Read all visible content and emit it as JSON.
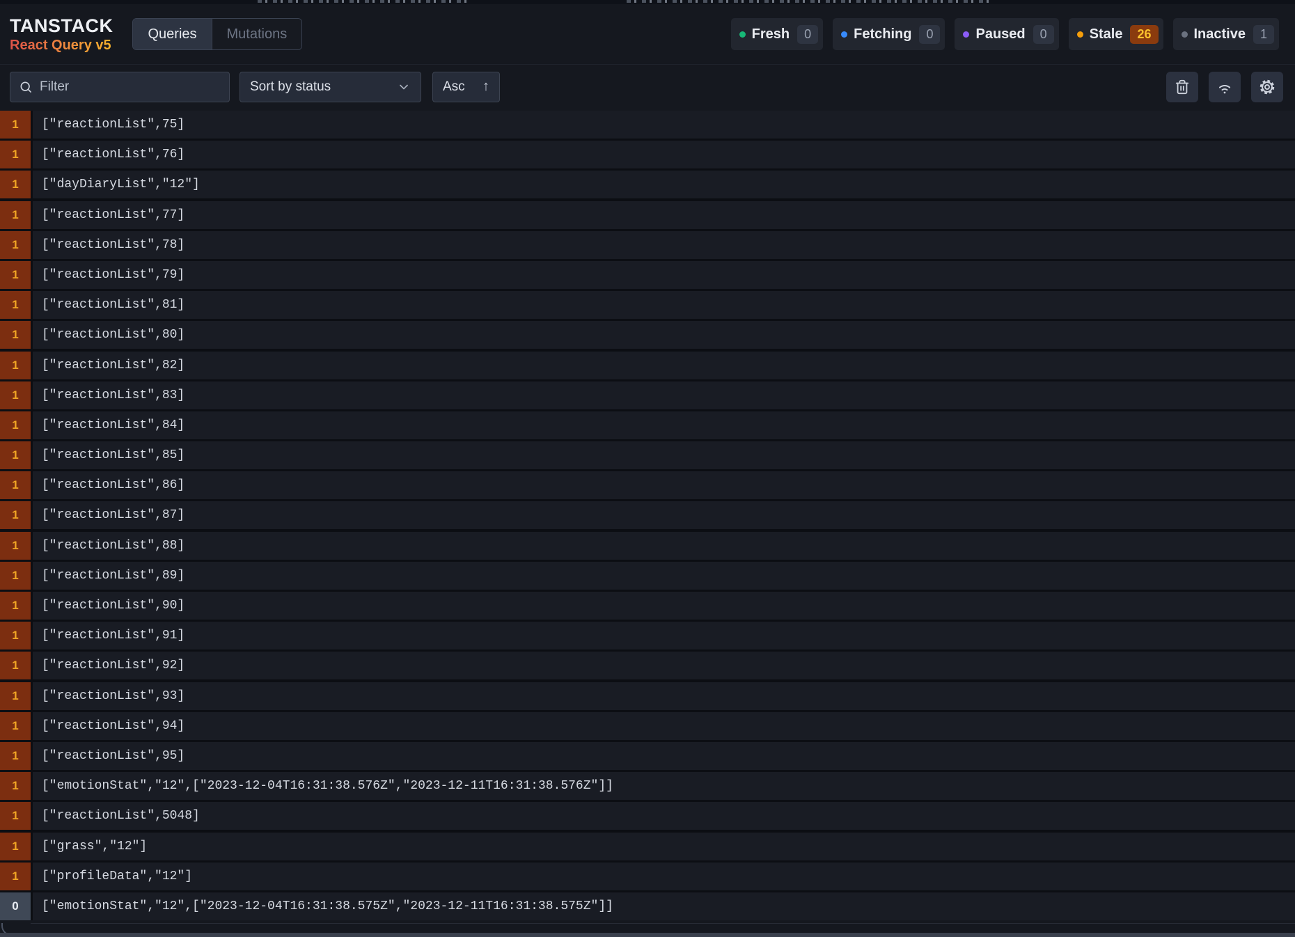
{
  "brand": {
    "title": "TANSTACK",
    "subtitle": "React Query v5"
  },
  "tabs": [
    {
      "label": "Queries",
      "active": true
    },
    {
      "label": "Mutations",
      "active": false
    }
  ],
  "status_badges": [
    {
      "label": "Fresh",
      "count": "0",
      "dot_color": "#17b877",
      "highlight": false
    },
    {
      "label": "Fetching",
      "count": "0",
      "dot_color": "#388bfd",
      "highlight": false
    },
    {
      "label": "Paused",
      "count": "0",
      "dot_color": "#8b5cf6",
      "highlight": false
    },
    {
      "label": "Stale",
      "count": "26",
      "dot_color": "#f59e0b",
      "highlight": true
    },
    {
      "label": "Inactive",
      "count": "1",
      "dot_color": "#6b7280",
      "highlight": false
    }
  ],
  "toolbar": {
    "filter_placeholder": "Filter",
    "sort_label": "Sort by status",
    "asc_label": "Asc",
    "asc_arrow": "↑"
  },
  "colors": {
    "stale_row_badge_bg": "#7c2e10",
    "stale_row_badge_text": "#f1a525",
    "inactive_row_badge_bg": "#3f4856",
    "stale_chip_bg": "#8a3b0e",
    "stale_chip_text": "#fbc22d"
  },
  "queries": [
    {
      "observers": "1",
      "state": "stale",
      "key": "[\"reactionList\",75]"
    },
    {
      "observers": "1",
      "state": "stale",
      "key": "[\"reactionList\",76]"
    },
    {
      "observers": "1",
      "state": "stale",
      "key": "[\"dayDiaryList\",\"12\"]"
    },
    {
      "observers": "1",
      "state": "stale",
      "key": "[\"reactionList\",77]"
    },
    {
      "observers": "1",
      "state": "stale",
      "key": "[\"reactionList\",78]"
    },
    {
      "observers": "1",
      "state": "stale",
      "key": "[\"reactionList\",79]"
    },
    {
      "observers": "1",
      "state": "stale",
      "key": "[\"reactionList\",81]"
    },
    {
      "observers": "1",
      "state": "stale",
      "key": "[\"reactionList\",80]"
    },
    {
      "observers": "1",
      "state": "stale",
      "key": "[\"reactionList\",82]"
    },
    {
      "observers": "1",
      "state": "stale",
      "key": "[\"reactionList\",83]"
    },
    {
      "observers": "1",
      "state": "stale",
      "key": "[\"reactionList\",84]"
    },
    {
      "observers": "1",
      "state": "stale",
      "key": "[\"reactionList\",85]"
    },
    {
      "observers": "1",
      "state": "stale",
      "key": "[\"reactionList\",86]"
    },
    {
      "observers": "1",
      "state": "stale",
      "key": "[\"reactionList\",87]"
    },
    {
      "observers": "1",
      "state": "stale",
      "key": "[\"reactionList\",88]"
    },
    {
      "observers": "1",
      "state": "stale",
      "key": "[\"reactionList\",89]"
    },
    {
      "observers": "1",
      "state": "stale",
      "key": "[\"reactionList\",90]"
    },
    {
      "observers": "1",
      "state": "stale",
      "key": "[\"reactionList\",91]"
    },
    {
      "observers": "1",
      "state": "stale",
      "key": "[\"reactionList\",92]"
    },
    {
      "observers": "1",
      "state": "stale",
      "key": "[\"reactionList\",93]"
    },
    {
      "observers": "1",
      "state": "stale",
      "key": "[\"reactionList\",94]"
    },
    {
      "observers": "1",
      "state": "stale",
      "key": "[\"reactionList\",95]"
    },
    {
      "observers": "1",
      "state": "stale",
      "key": "[\"emotionStat\",\"12\",[\"2023-12-04T16:31:38.576Z\",\"2023-12-11T16:31:38.576Z\"]]"
    },
    {
      "observers": "1",
      "state": "stale",
      "key": "[\"reactionList\",5048]"
    },
    {
      "observers": "1",
      "state": "stale",
      "key": "[\"grass\",\"12\"]"
    },
    {
      "observers": "1",
      "state": "stale",
      "key": "[\"profileData\",\"12\"]"
    },
    {
      "observers": "0",
      "state": "inactive",
      "key": "[\"emotionStat\",\"12\",[\"2023-12-04T16:31:38.575Z\",\"2023-12-11T16:31:38.575Z\"]]"
    }
  ]
}
